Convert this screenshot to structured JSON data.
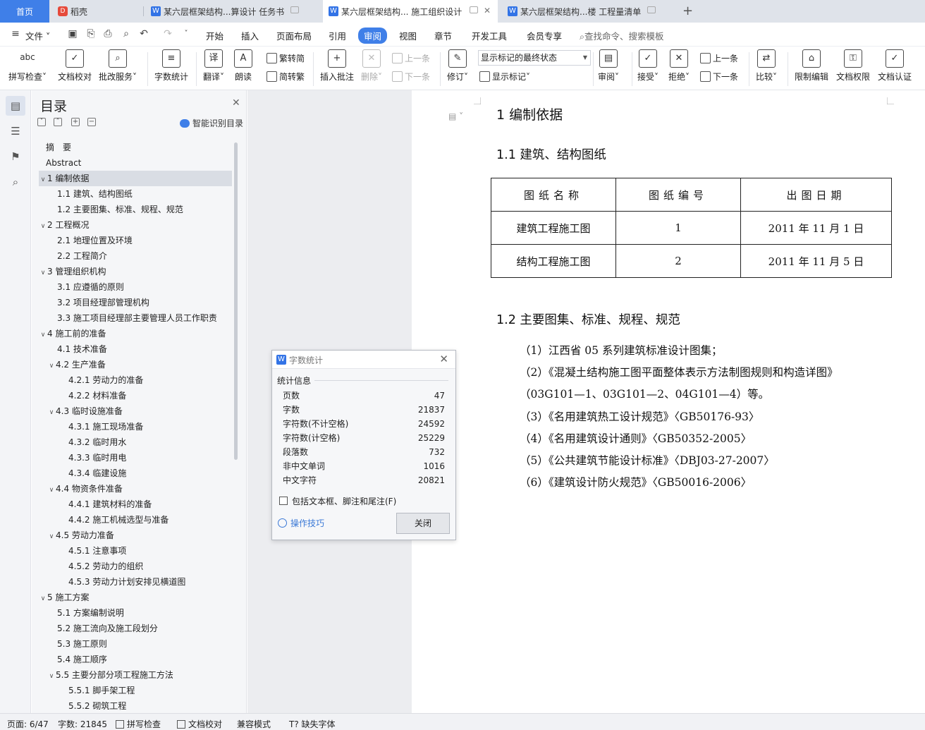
{
  "tabs": [
    {
      "label": "首页",
      "type": "home"
    },
    {
      "label": "稻壳",
      "type": "docer"
    },
    {
      "label": "某六层框架结构...算设计 任务书",
      "type": "doc"
    },
    {
      "label": "某六层框架结构... 施工组织设计",
      "type": "doc",
      "active": true
    },
    {
      "label": "某六层框架结构...楼 工程量清单",
      "type": "doc"
    }
  ],
  "menu": {
    "file": "文件",
    "items": [
      "开始",
      "插入",
      "页面布局",
      "引用",
      "审阅",
      "视图",
      "章节",
      "开发工具",
      "会员专享"
    ],
    "active": "审阅",
    "search": "查找命令、搜索模板"
  },
  "ribbon": {
    "spellcheck": "拼写检查",
    "doccheck": "文档校对",
    "batch": "批改服务",
    "wordcount": "字数统计",
    "translate": "翻译",
    "read": "朗读",
    "trad": "繁转简",
    "simp": "简转繁",
    "insert_comment": "插入批注",
    "delete": "删除",
    "prev": "上一条",
    "next": "下一条",
    "revise": "修订",
    "markup_state": "显示标记的最终状态",
    "show_markup": "显示标记",
    "review": "审阅",
    "accept": "接受",
    "reject": "拒绝",
    "prev2": "上一条",
    "next2": "下一条",
    "compare": "比较",
    "restrict": "限制编辑",
    "doc_perm": "文档权限",
    "doc_cert": "文档认证"
  },
  "nav": {
    "title": "目录",
    "smart": "智能识别目录",
    "items": [
      {
        "label": "摘　要",
        "level": 0,
        "caret": ""
      },
      {
        "label": "Abstract",
        "level": 0,
        "caret": ""
      },
      {
        "label": "1 编制依据",
        "level": 0,
        "caret": "v",
        "selected": true
      },
      {
        "label": "1.1  建筑、结构图纸",
        "level": 1,
        "caret": ""
      },
      {
        "label": "1.2  主要图集、标准、规程、规范",
        "level": 1,
        "caret": ""
      },
      {
        "label": "2 工程概况",
        "level": 0,
        "caret": "v"
      },
      {
        "label": "2.1  地理位置及环境",
        "level": 1,
        "caret": ""
      },
      {
        "label": "2.2  工程简介",
        "level": 1,
        "caret": ""
      },
      {
        "label": "3 管理组织机构",
        "level": 0,
        "caret": "v"
      },
      {
        "label": "3.1  应遵循的原则",
        "level": 1,
        "caret": ""
      },
      {
        "label": "3.2  项目经理部管理机构",
        "level": 1,
        "caret": ""
      },
      {
        "label": "3.3  施工项目经理部主要管理人员工作职责",
        "level": 1,
        "caret": ""
      },
      {
        "label": "4 施工前的准备",
        "level": 0,
        "caret": "v"
      },
      {
        "label": "4.1 技术准备",
        "level": 1,
        "caret": ""
      },
      {
        "label": "4.2 生产准备",
        "level": 1,
        "caret": "v"
      },
      {
        "label": "4.2.1 劳动力的准备",
        "level": 2,
        "caret": ""
      },
      {
        "label": "4.2.2 材料准备",
        "level": 2,
        "caret": ""
      },
      {
        "label": "4.3  临时设施准备",
        "level": 1,
        "caret": "v"
      },
      {
        "label": "4.3.1 施工现场准备",
        "level": 2,
        "caret": ""
      },
      {
        "label": "4.3.2 临时用水",
        "level": 2,
        "caret": ""
      },
      {
        "label": "4.3.3  临时用电",
        "level": 2,
        "caret": ""
      },
      {
        "label": "4.3.4 临建设施",
        "level": 2,
        "caret": ""
      },
      {
        "label": "4.4 物资条件准备",
        "level": 1,
        "caret": "v"
      },
      {
        "label": "4.4.1  建筑材料的准备",
        "level": 2,
        "caret": ""
      },
      {
        "label": "4.4.2 施工机械选型与准备",
        "level": 2,
        "caret": ""
      },
      {
        "label": "4.5 劳动力准备",
        "level": 1,
        "caret": "v"
      },
      {
        "label": "4.5.1  注意事项",
        "level": 2,
        "caret": ""
      },
      {
        "label": "4.5.2 劳动力的组织",
        "level": 2,
        "caret": ""
      },
      {
        "label": "4.5.3  劳动力计划安排见横道图",
        "level": 2,
        "caret": ""
      },
      {
        "label": "5 施工方案",
        "level": 0,
        "caret": "v"
      },
      {
        "label": "5.1  方案编制说明",
        "level": 1,
        "caret": ""
      },
      {
        "label": "5.2 施工流向及施工段划分",
        "level": 1,
        "caret": ""
      },
      {
        "label": "5.3 施工原则",
        "level": 1,
        "caret": ""
      },
      {
        "label": "5.4  施工顺序",
        "level": 1,
        "caret": ""
      },
      {
        "label": "5.5 主要分部分项工程施工方法",
        "level": 1,
        "caret": "v"
      },
      {
        "label": "5.5.1 脚手架工程",
        "level": 2,
        "caret": ""
      },
      {
        "label": "5.5.2 砌筑工程",
        "level": 2,
        "caret": ""
      }
    ]
  },
  "doc": {
    "h1": "1 编制依据",
    "h2a": "1.1  建筑、结构图纸",
    "table": {
      "headers": [
        "图纸名称",
        "图纸编号",
        "出图日期"
      ],
      "rows": [
        [
          "建筑工程施工图",
          "1",
          "2011 年 11 月 1 日"
        ],
        [
          "结构工程施工图",
          "2",
          "2011 年 11 月 5 日"
        ]
      ]
    },
    "h2b": "1.2  主要图集、标准、规程、规范",
    "paras": [
      "（1）江西省 05 系列建筑标准设计图集；",
      "（2）《混凝土结构施工图平面整体表示方法制图规则和构造详图》",
      "（03G101—1、03G101—2、04G101—4）等。",
      "（3）《名用建筑热工设计规范》〈GB50176-93〉",
      "（4）《名用建筑设计通则》〈GB50352-2005〉",
      "（5）《公共建筑节能设计标准》〈DBJ03-27-2007〉",
      "（6）《建筑设计防火规范》〈GB50016-2006〉"
    ]
  },
  "dialog": {
    "title": "字数统计",
    "section": "统计信息",
    "stats": [
      {
        "label": "页数",
        "value": "47"
      },
      {
        "label": "字数",
        "value": "21837"
      },
      {
        "label": "字符数(不计空格)",
        "value": "24592"
      },
      {
        "label": "字符数(计空格)",
        "value": "25229"
      },
      {
        "label": "段落数",
        "value": "732"
      },
      {
        "label": "非中文单词",
        "value": "1016"
      },
      {
        "label": "中文字符",
        "value": "20821"
      }
    ],
    "checkbox": "包括文本框、脚注和尾注(F)",
    "tips": "操作技巧",
    "close": "关闭"
  },
  "status": {
    "page": "页面: 6/47",
    "words": "字数: 21845",
    "spell": "拼写检查",
    "doccheck": "文档校对",
    "compat": "兼容模式",
    "missing_font": "缺失字体"
  },
  "colors": {
    "accent": "#3f7fe8",
    "tabbar": "#dfe3ea",
    "docbg": "#ecedf0"
  }
}
